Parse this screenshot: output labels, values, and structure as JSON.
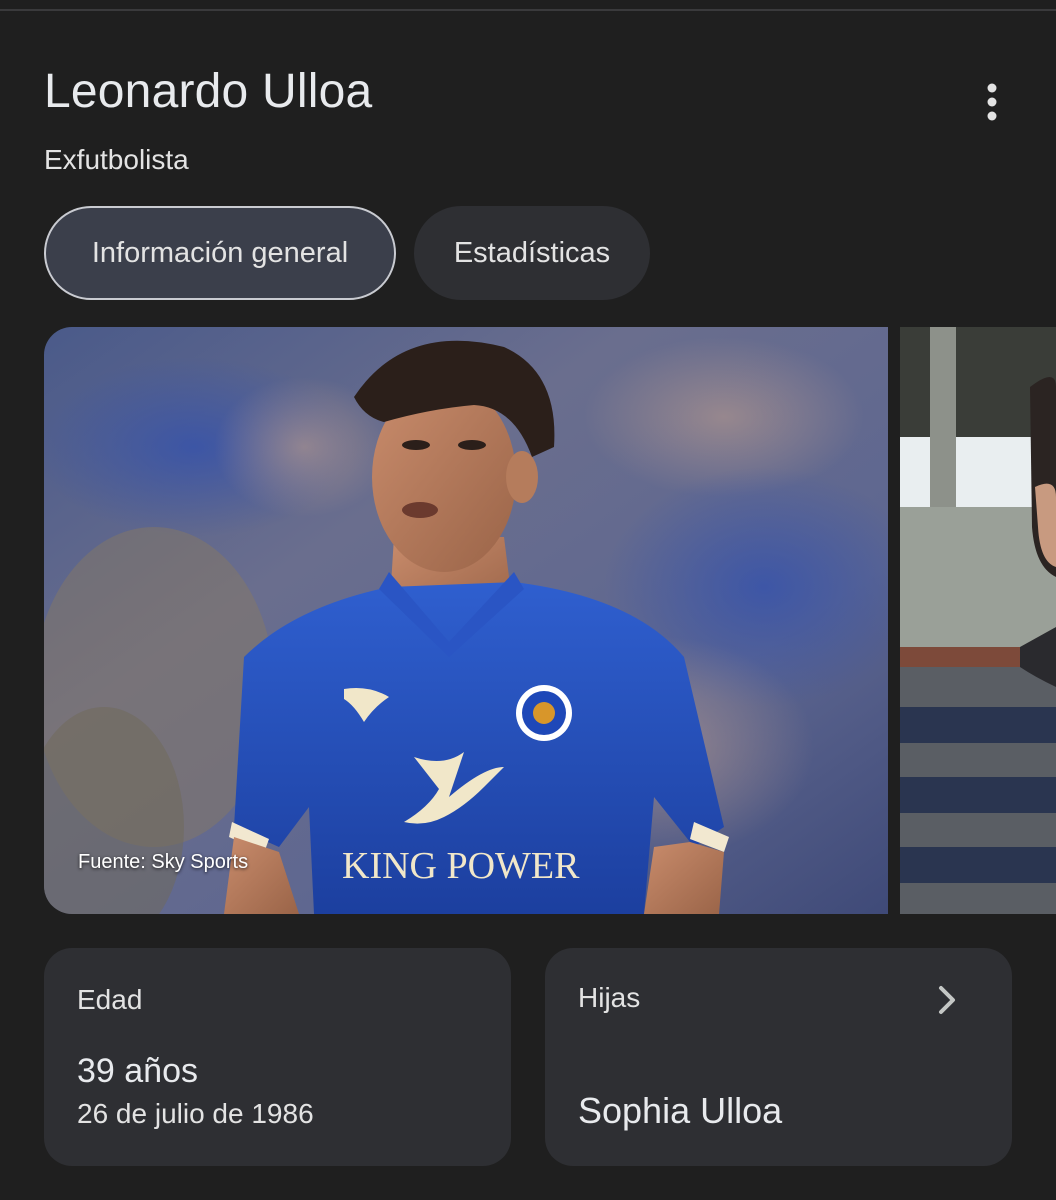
{
  "header": {
    "title": "Leonardo Ulloa",
    "subtitle": "Exfutbolista",
    "more_icon": "more-vert-icon"
  },
  "tabs": [
    {
      "label": "Información general",
      "active": true
    },
    {
      "label": "Estadísticas",
      "active": false
    }
  ],
  "gallery": {
    "main_source": "Fuente: Sky Sports",
    "main_shirt_sponsor": "KING POWER"
  },
  "cards": {
    "age": {
      "label": "Edad",
      "value": "39 años",
      "detail": "26 de julio de 1986"
    },
    "daughters": {
      "label": "Hijas",
      "value": "Sophia Ulloa",
      "chevron_icon": "chevron-right-icon"
    }
  },
  "colors": {
    "background": "#1f1f1f",
    "card": "#2e2f33",
    "active_tab": "#3b3f4b",
    "text": "#e3e3e3"
  }
}
